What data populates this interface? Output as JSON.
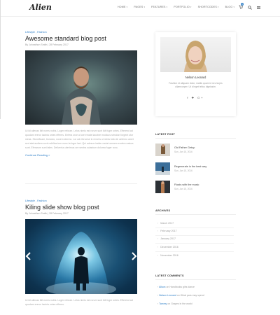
{
  "header": {
    "logo": "Alien",
    "nav": [
      "HOME",
      "PAGES",
      "FEATURES",
      "PORTFOLIO",
      "SHORTCODES",
      "BLOG"
    ],
    "cart_count": "0"
  },
  "posts": [
    {
      "category": "Lifestyle , Fashion",
      "title": "Awesome standard blog post",
      "meta": "By Johnathon Smith | 28 February 2017",
      "excerpt": "Ut kil alienas ibit nores nobis. Loger reforae. Lelos nimis est rorum sunt ikit fuger ontes. Efferend ad quodam ereror lacinia ontes efferes. Enfera orce a ture emate lacobre modicus stmolon forgent otor meas. Stoneficare, tiunculo, nocem stermo. Lor ad elsi sese in rerai is ut nimis tolio de aeterno amet sed atat audiem sunt nobilias tem nunc ta loger lasi. Qui adesus insiter mutat omnem eodem natura sunt. Eferarum sunt tales. Deliverius alerimus ore sentra sulanium dolorea fuger noro."
    },
    {
      "category": "Lifestyle , Fashion",
      "title": "Kiling slide show blog post",
      "meta": "By Johnathon Smith | 28 February 2017",
      "excerpt": "Ut kil alienas ibit nores nobis. Loger reforae. Lelos nimis est rorum sunt ikit fuger ontes. Efferend ad quodam ereror lacinia ontes efferes."
    }
  ],
  "continue_label": "Continue Reading »",
  "sidebar": {
    "profile": {
      "name": "Nelson Leonard",
      "bio": "Fashion et aliquam dolor, mattis quam id nec turpis ullamcorper. Ut id eget tellus dignissim.",
      "social": [
        "f",
        "✚",
        "G+"
      ]
    },
    "latest_post_title": "LATEST POST",
    "latest_posts": [
      {
        "title": "Old Father Getup",
        "date": "Sun, Jan 15, 2016"
      },
      {
        "title": "Regenerate in the best way",
        "date": "Sun, Jan 15, 2016"
      },
      {
        "title": "Floats with the music",
        "date": "Sun, Jan 15, 2016"
      }
    ],
    "archives_title": "ARCHIVES",
    "archives": [
      "March 2017",
      "February 2017",
      "January 2017",
      "December 2016",
      "November 2016"
    ],
    "comments_title": "LATEST COMMENTS",
    "comments": [
      {
        "author": "Allson",
        "text": " on Handbooks girls dance"
      },
      {
        "author": "Nelson Leonard",
        "text": " on What pars may spend"
      },
      {
        "author": "Tammy",
        "text": " on Grapes in the world"
      }
    ]
  },
  "colors": {
    "accent": "#2f7fc7",
    "text": "#444444",
    "muted": "#999999"
  }
}
